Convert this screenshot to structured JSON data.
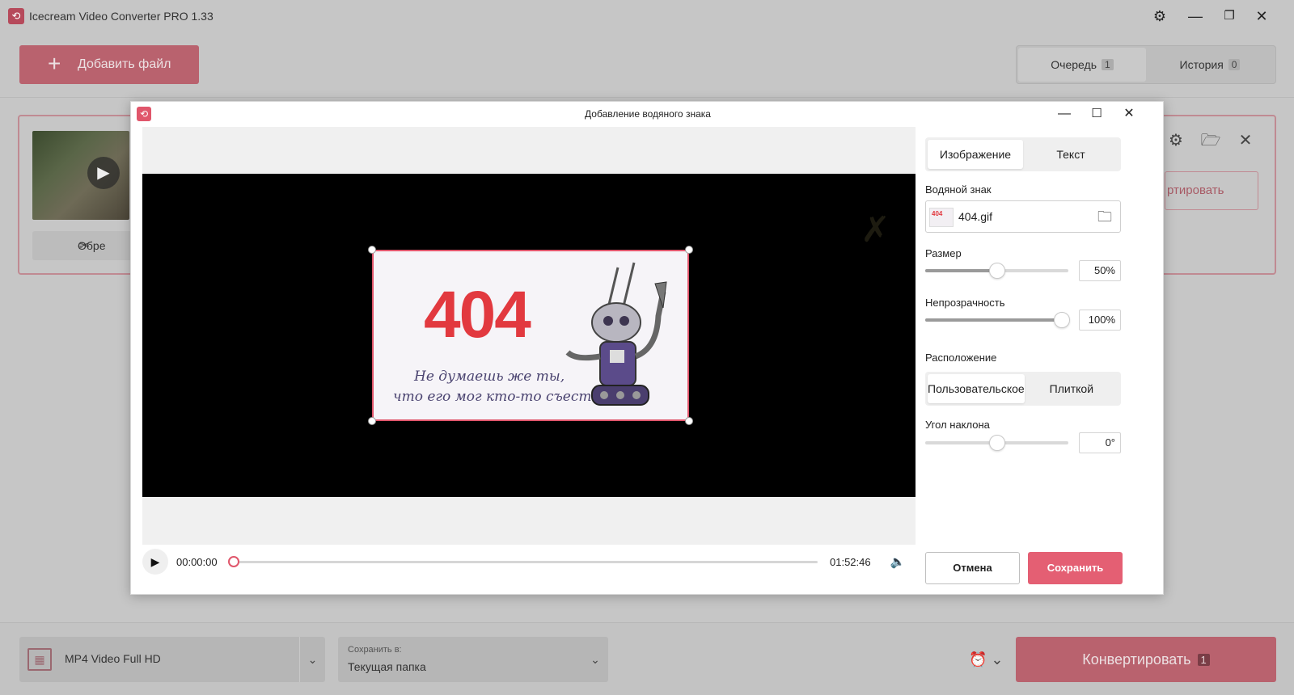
{
  "app": {
    "title": "Icecream Video Converter PRO 1.33",
    "logo_icon": "icecream-logo-icon"
  },
  "toolbar": {
    "add_file_label": "Добавить файл"
  },
  "tabs": [
    {
      "label": "Очередь",
      "count": "1",
      "active": true
    },
    {
      "label": "История",
      "count": "0",
      "active": false
    }
  ],
  "file_card": {
    "trim_label": "Обре",
    "convert_label": "ртировать"
  },
  "bottom": {
    "format_label": "MP4 Video Full HD",
    "save_caption": "Сохранить в:",
    "save_value": "Текущая папка",
    "convert_label": "Конвертировать",
    "convert_count": "1"
  },
  "dialog": {
    "title": "Добавление водяного знака",
    "watermark_text": {
      "big": "404",
      "line1": "Не думаешь же ты,",
      "line2": "что его мог кто-то съесть?.."
    },
    "player": {
      "current_time": "00:00:00",
      "total_time": "01:52:46",
      "progress": 0
    },
    "panel": {
      "mode_tabs": [
        {
          "label": "Изображение",
          "active": true
        },
        {
          "label": "Текст",
          "active": false
        }
      ],
      "watermark_label": "Водяной знак",
      "file_name": "404.gif",
      "size_label": "Размер",
      "size_value": "50%",
      "size_level": 0.5,
      "opacity_label": "Непрозрачность",
      "opacity_value": "100%",
      "opacity_level": 1.0,
      "position_label": "Расположение",
      "position_tabs": [
        {
          "label": "Пользовательское",
          "active": true
        },
        {
          "label": "Плиткой",
          "active": false
        }
      ],
      "angle_label": "Угол наклона",
      "angle_value": "0°",
      "angle_level": 0.5,
      "cancel_label": "Отмена",
      "save_label": "Сохранить"
    }
  },
  "colors": {
    "accent": "#e45f73",
    "accent_dim": "#b9626e",
    "overlay_bg": "#c6c6c6"
  }
}
